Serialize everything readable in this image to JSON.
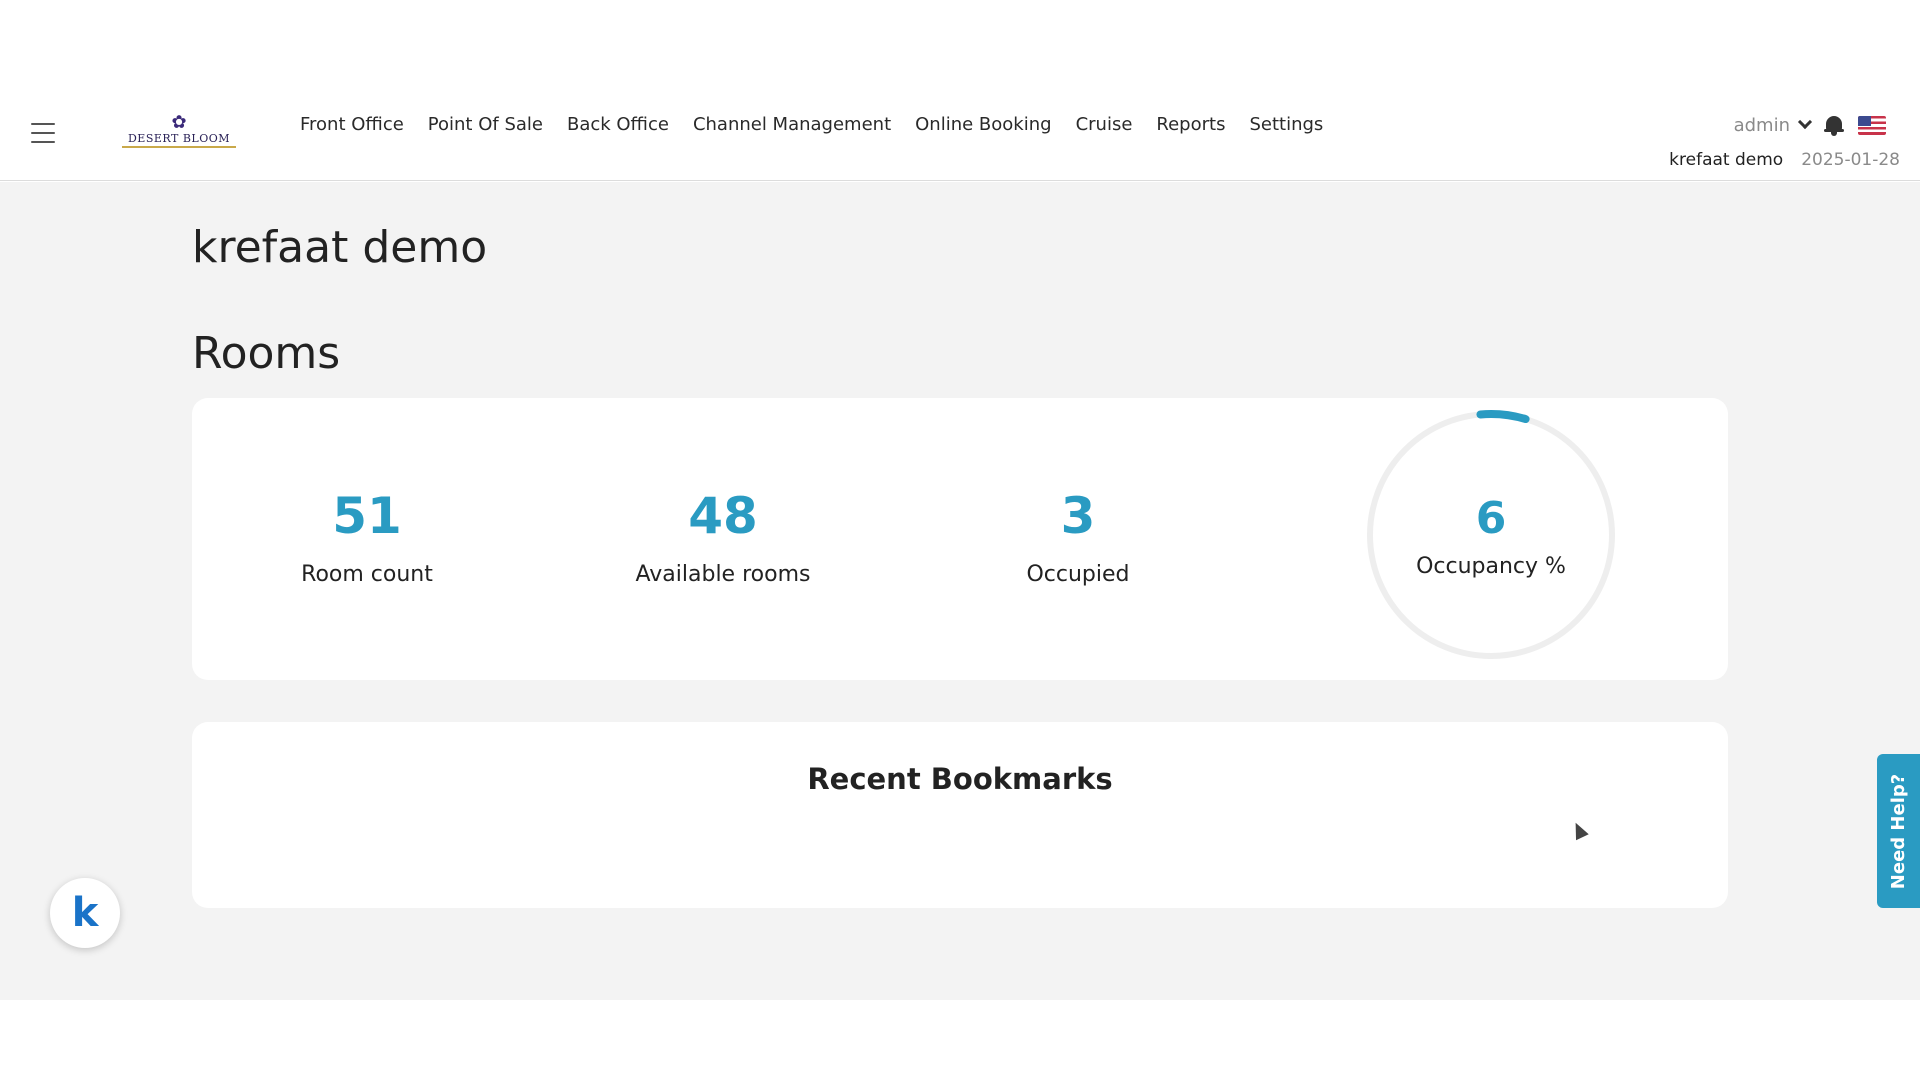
{
  "nav": {
    "logo_text": "DESERT BLOOM",
    "menu": [
      "Front Office",
      "Point Of Sale",
      "Back Office",
      "Channel Management",
      "Online Booking",
      "Cruise",
      "Reports",
      "Settings"
    ],
    "user": "admin",
    "hotel": "krefaat demo",
    "date": "2025-01-28"
  },
  "page": {
    "title": "krefaat demo",
    "rooms_heading": "Rooms"
  },
  "stats": {
    "room_count": {
      "value": "51",
      "label": "Room count"
    },
    "available": {
      "value": "48",
      "label": "Available rooms"
    },
    "occupied": {
      "value": "3",
      "label": "Occupied"
    },
    "occupancy": {
      "value": "6",
      "label": "Occupancy %",
      "fraction": 0.06
    }
  },
  "bookmarks": {
    "title": "Recent Bookmarks"
  },
  "help": {
    "label": "Need Help?"
  },
  "badge": {
    "letter": "k"
  },
  "colors": {
    "accent": "#2a9bc2",
    "track": "#eeeeee"
  }
}
